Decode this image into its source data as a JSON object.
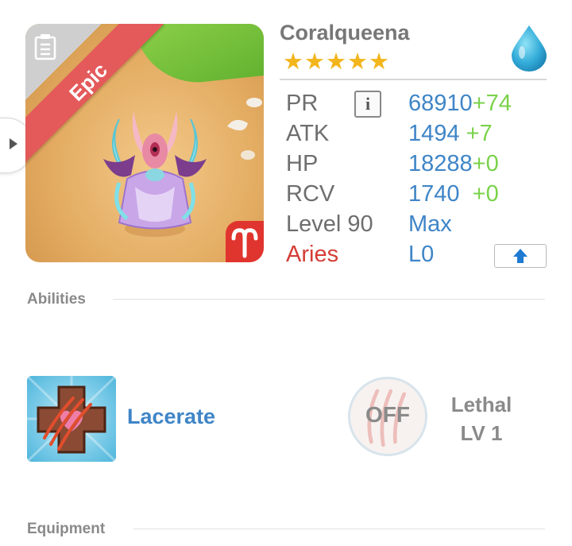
{
  "monster": {
    "name": "Coralqueena",
    "rarity": "Epic",
    "stars": 5,
    "stars_text": "★★★★★",
    "element_icon": "water-drop-icon",
    "sign_icon": "aries-icon",
    "card_icon": "note-icon"
  },
  "stats": {
    "pr": {
      "label": "PR",
      "value": "68910",
      "bonus": "+74"
    },
    "atk": {
      "label": "ATK",
      "value": "1494",
      "bonus": "+7"
    },
    "hp": {
      "label": "HP",
      "value": "18288",
      "bonus": "+0"
    },
    "rcv": {
      "label": "RCV",
      "value": "1740",
      "bonus": "+0"
    },
    "level": {
      "label": "Level 90",
      "value": "Max"
    },
    "zodiac": {
      "label": "Aries",
      "value": "L0"
    }
  },
  "info_button_label": "i",
  "upgrade_icon": "up-arrow-icon",
  "sections": {
    "abilities": "Abilities",
    "equipment": "Equipment"
  },
  "abilities": {
    "active": {
      "name": "Lacerate",
      "icon": "lacerate-icon"
    },
    "passive": {
      "toggle": "OFF",
      "name": "Lethal",
      "level": "LV 1"
    }
  },
  "colors": {
    "epic_ribbon": "#e4595a",
    "value_blue": "#3f85c7",
    "bonus_green": "#7ad24a",
    "aries_red": "#d53c35",
    "star_gold": "#f3b51c"
  }
}
